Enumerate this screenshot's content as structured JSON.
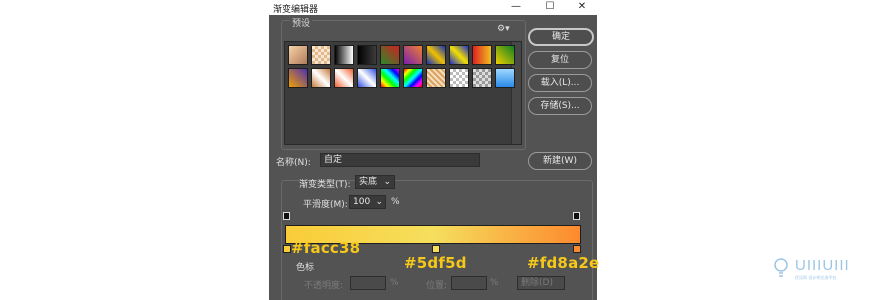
{
  "window": {
    "title": "渐变编辑器",
    "controls": {
      "minimize": "—",
      "maximize": "☐",
      "close": "✕"
    }
  },
  "presets": {
    "label": "预设",
    "gear_glyph": "⚙▾",
    "swatches_row1": [
      "linear-gradient(135deg,#f6d2a8,#b07c5a)",
      "repeating-conic-gradient(#e2b88c 0 25%,#f6e6d2 0 50%) 0 0/6px 6px",
      "linear-gradient(90deg,#000,#fff)",
      "linear-gradient(90deg,#000,rgba(0,0,0,0))",
      "linear-gradient(45deg,#2a8a2a,#d02020)",
      "linear-gradient(45deg,#7a1fb0,#f08030)",
      "linear-gradient(45deg,#1030c0,#f0c000,#1030c0)",
      "linear-gradient(45deg,#1d2dcc,#f3e000,#1d2dcc)",
      "linear-gradient(90deg,#e02020,#f0c020)",
      "linear-gradient(45deg,#f0d000,#108020)"
    ],
    "swatches_row2": [
      "linear-gradient(45deg,#f0a000,#5030b0)",
      "linear-gradient(45deg,#c87a3a,#fff,#c87a3a)",
      "linear-gradient(45deg,#f06030,#fff,#f06030)",
      "linear-gradient(45deg,#3050e0,#fff,#3050e0)",
      "linear-gradient(45deg,#f00,#ff0,#0f0,#0ff,#00f,#f0f)",
      "linear-gradient(135deg,#f00,#ff0,#0f0,#0ff,#00f,#f0f,#f00)",
      "repeating-linear-gradient(45deg,#f0e0c0 0 2px,#e0a060 2px 4px)",
      "repeating-conic-gradient(#bbb 0 25%,#fff 0 50%) 0 0/6px 6px",
      "repeating-conic-gradient(#999 0 25%,#ddd 0 50%) 0 0/6px 6px",
      "linear-gradient(180deg,#9fd8ff,#2a8ae8)"
    ]
  },
  "buttons": {
    "ok": "确定",
    "reset": "复位",
    "load": "载入(L)...",
    "save": "存储(S)...",
    "new": "新建(W)"
  },
  "name_row": {
    "label": "名称(N):",
    "value": "自定"
  },
  "gradient_type": {
    "label": "渐变类型(T):",
    "value": "实底"
  },
  "smoothness": {
    "label": "平滑度(M):",
    "value": "100",
    "unit": "%"
  },
  "gradient": {
    "colors": [
      "#facc38",
      "#f5df5d",
      "#fd8a2e"
    ],
    "css": "linear-gradient(90deg,#facc38 0%,#f5df5d 50%,#fd8a2e 100%)"
  },
  "annotations": {
    "left": "#facc38",
    "middle": "#5df5d",
    "right": "#fd8a2e"
  },
  "stops_section": {
    "label": "色标",
    "opacity_label": "不透明度:",
    "opacity_unit": "%",
    "position_label": "位置:",
    "position_unit": "%",
    "delete_label": "删除(D)"
  },
  "logo": {
    "text": "UIIIUIII",
    "sub": "优设网 设计师交流平台"
  }
}
